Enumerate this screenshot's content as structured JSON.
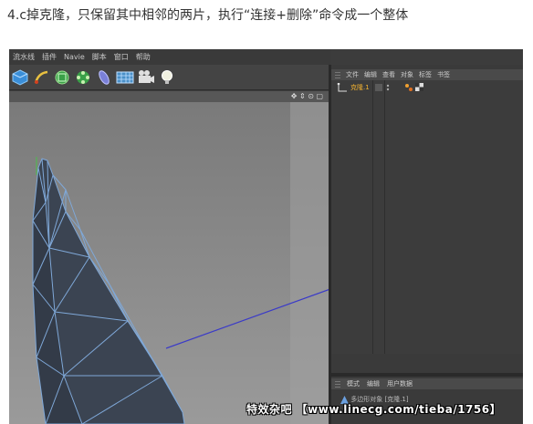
{
  "caption": "4.c掉克隆，只保留其中相邻的两片，执行“连接+删除”命令成一个整体",
  "menu": [
    "流水线",
    "插件",
    "Navie",
    "脚本",
    "窗口",
    "帮助"
  ],
  "toolbar_icons": [
    "cube-icon",
    "pen-icon",
    "subdivision-icon",
    "array-icon",
    "deformer-icon",
    "floor-icon",
    "camera-icon",
    "light-icon"
  ],
  "viewport": {
    "nav_icons": "✥ ⇕ ⊙ ▢"
  },
  "object_manager": {
    "tabs": [
      "文件",
      "编辑",
      "查看",
      "对象",
      "标签",
      "书签"
    ],
    "objects": [
      {
        "name": "克隆.1",
        "icon": "null-object-icon"
      }
    ]
  },
  "attribute_manager": {
    "tabs": [
      "模式",
      "编辑",
      "用户数据"
    ],
    "selection": "多边形对象 [克隆.1]"
  },
  "watermark": "特效杂吧 【www.linecg.com/tieba/1756】",
  "colors": {
    "background": "#3c3c3c",
    "viewport": "#8a8a8a",
    "mesh": "#3f4857",
    "wireframe": "#7fa8d8",
    "selection": "#f0b030"
  }
}
